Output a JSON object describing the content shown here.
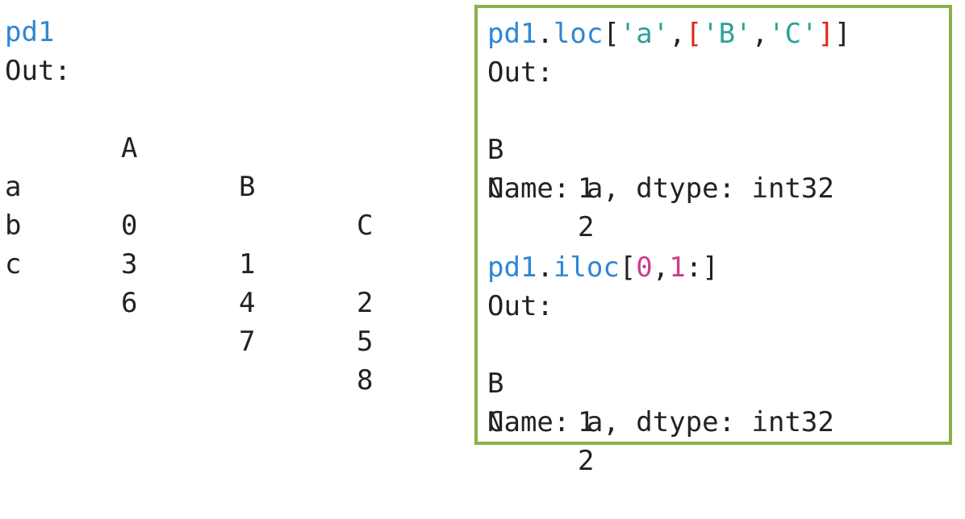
{
  "left": {
    "cmd": "pd1",
    "out_label": "Out:",
    "columns": [
      "A",
      "B",
      "C"
    ],
    "rows": [
      {
        "index": "a",
        "values": [
          "0",
          "1",
          "2"
        ]
      },
      {
        "index": "b",
        "values": [
          "3",
          "4",
          "5"
        ]
      },
      {
        "index": "c",
        "values": [
          "6",
          "7",
          "8"
        ]
      }
    ]
  },
  "right": {
    "loc": {
      "obj": "pd1",
      "dot": ".",
      "method": "loc",
      "open": "[",
      "arg1": "'a'",
      "comma": ",",
      "list_open": "[",
      "arg2": "'B'",
      "comma2": ",",
      "arg3": "'C'",
      "list_close": "]",
      "close": "]",
      "out_label": "Out:",
      "rows": [
        {
          "index": "B",
          "value": "1"
        },
        {
          "index": "C",
          "value": "2"
        }
      ],
      "footer": "Name: a, dtype: int32"
    },
    "iloc": {
      "obj": "pd1",
      "dot": ".",
      "method": "iloc",
      "open": "[",
      "arg1": "0",
      "comma": ",",
      "arg2": "1",
      "slice": ":",
      "close": "]",
      "out_label": "Out:",
      "rows": [
        {
          "index": "B",
          "value": "1"
        },
        {
          "index": "C",
          "value": "2"
        }
      ],
      "footer": "Name: a, dtype: int32"
    }
  },
  "colors": {
    "code_blue": "#2f86d3",
    "string_teal": "#2aa198",
    "bracket_red": "#e0241b",
    "number_pink": "#cc3d8a",
    "panel_border": "#8cb04a"
  }
}
